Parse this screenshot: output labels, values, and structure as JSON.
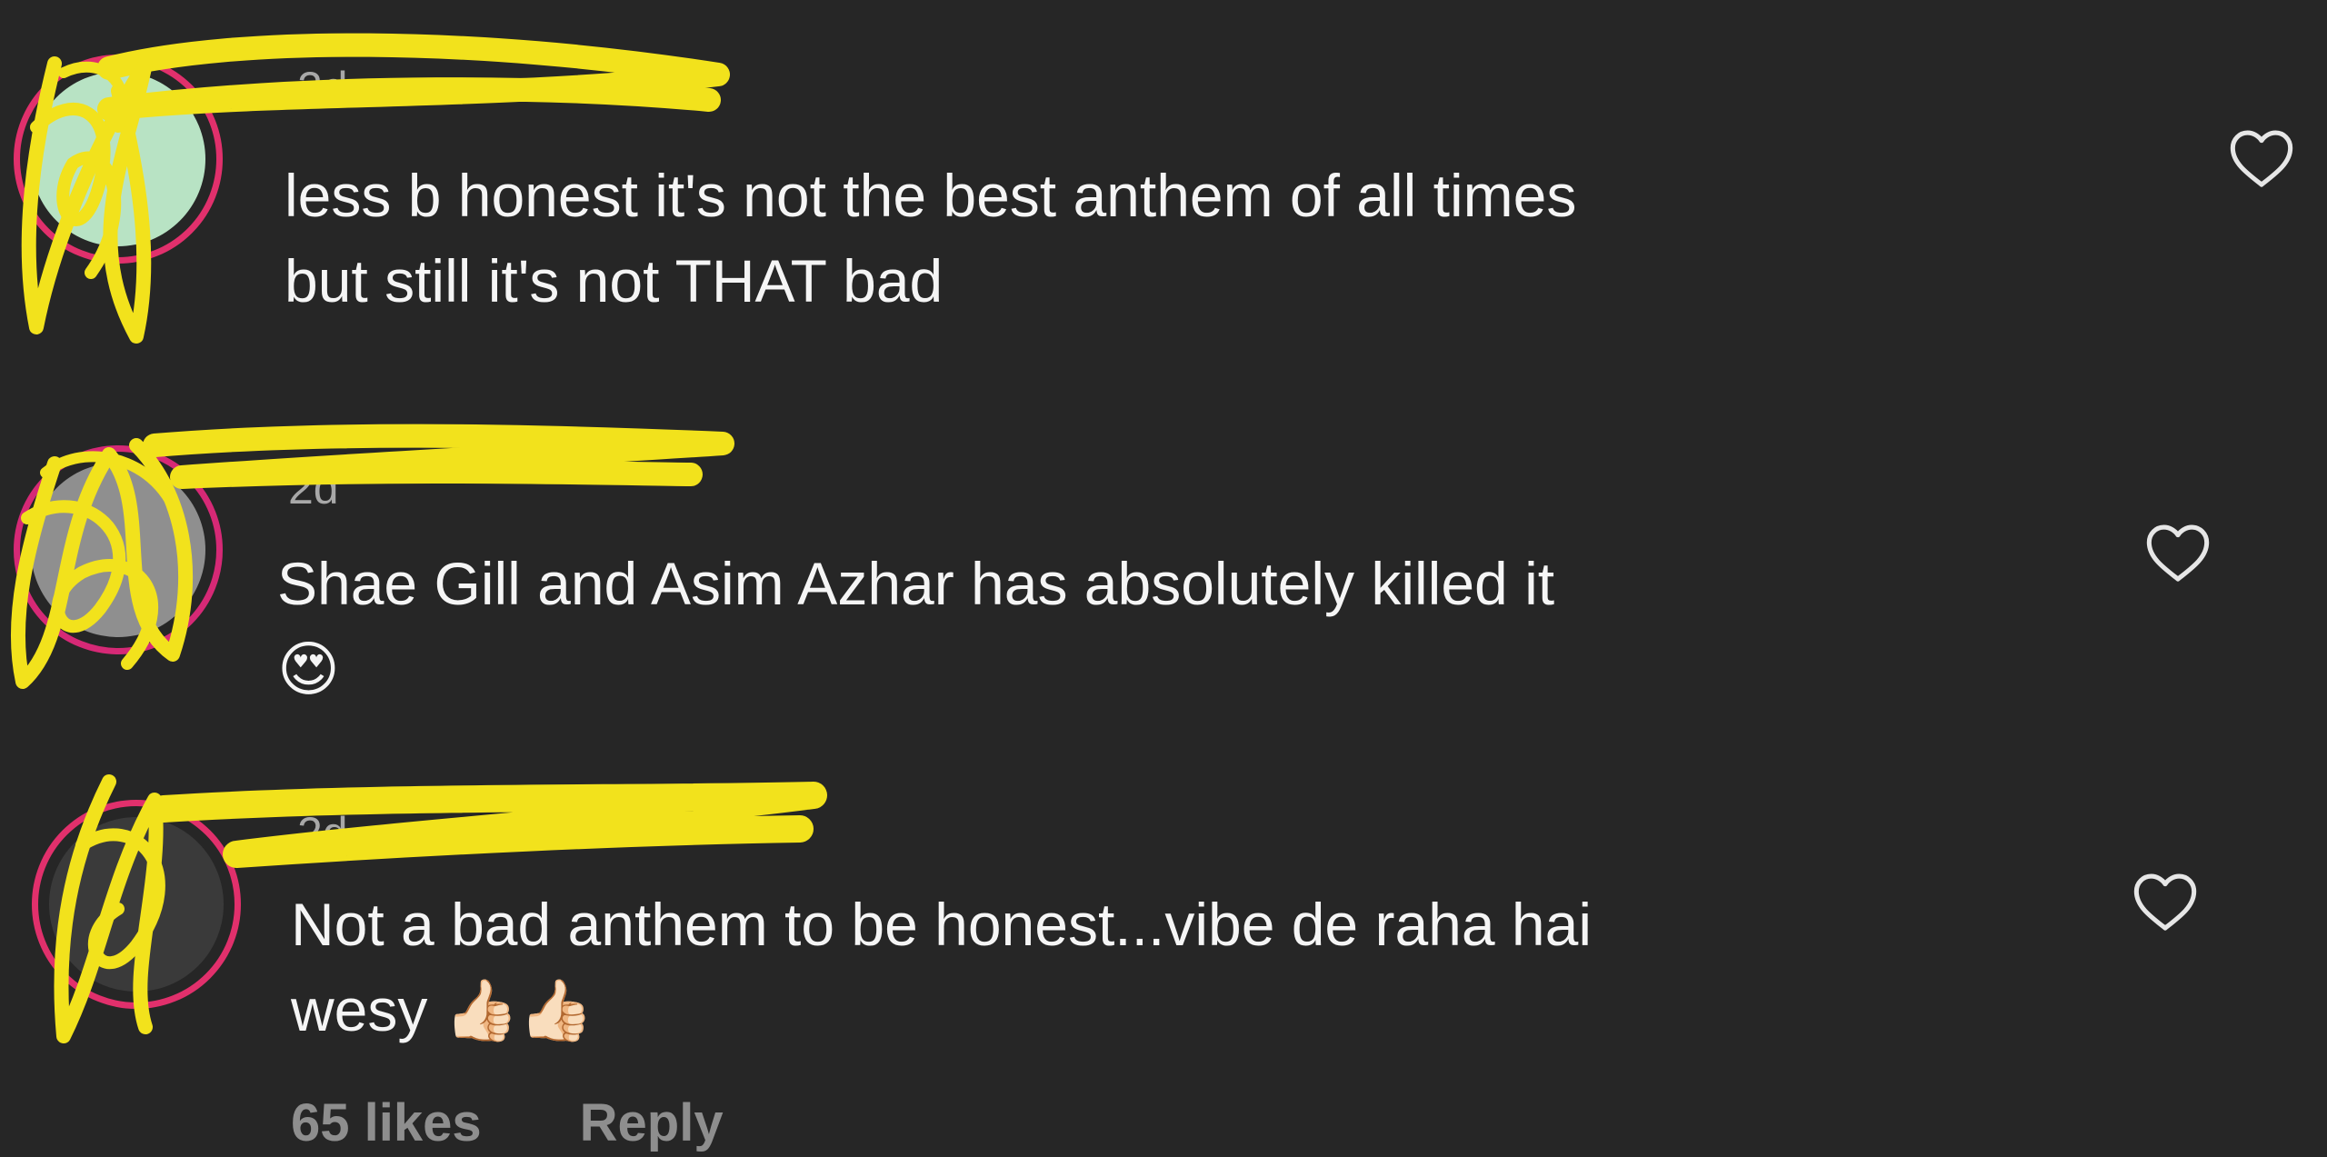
{
  "comments": [
    {
      "username": "",
      "time": "2d",
      "text_line1": "less b honest it's not the best anthem of all times",
      "text_line2": "but still it's not THAT bad"
    },
    {
      "username": "",
      "time": "2d",
      "text_line1": "Shae Gill and Asim Azhar has absolutely killed it",
      "text_line2": "😍"
    },
    {
      "username": "",
      "time": "2d",
      "text_line1": "Not a bad anthem to be honest...vibe de raha hai",
      "text_line2": "wesy 👍🏻👍🏻",
      "likes": "65 likes",
      "reply": "Reply"
    }
  ],
  "icons": {
    "like": "heart-outline-icon"
  },
  "colors": {
    "background": "#262626",
    "text": "#f5f5f5",
    "muted": "#a8a8a8",
    "redaction": "#f2e21c"
  }
}
